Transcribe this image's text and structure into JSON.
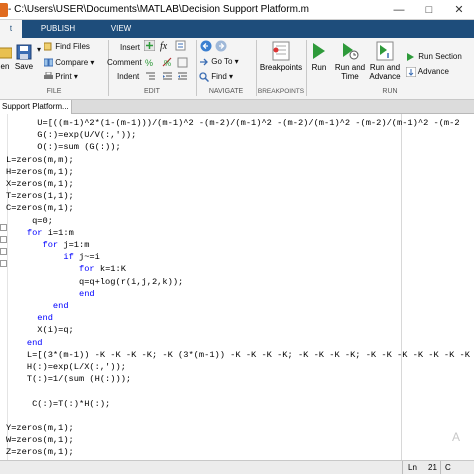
{
  "window": {
    "title": "- C:\\Users\\USER\\Documents\\MATLAB\\Decision Support Platform.m",
    "min_glyph": "—",
    "max_glyph": "□",
    "close_glyph": "✕"
  },
  "tabs": [
    {
      "label": "t"
    },
    {
      "label": "PUBLISH"
    },
    {
      "label": "VIEW"
    }
  ],
  "ribbon": {
    "file": {
      "open_label": "en",
      "save_label": "Save",
      "find_files": "Find Files",
      "compare": "Compare",
      "print": "Print",
      "group": "FILE"
    },
    "edit": {
      "insert": "Insert",
      "comment": "Comment",
      "indent": "Indent",
      "group": "EDIT"
    },
    "navigate": {
      "goto": "Go To",
      "find": "Find",
      "group": "NAVIGATE"
    },
    "breakpoints": {
      "label": "Breakpoints",
      "group": "BREAKPOINTS"
    },
    "run": {
      "run": "Run",
      "run_and_time": "Run and Time",
      "run_and_advance": "Run and Advance",
      "run_section": "Run Section",
      "advance": "Advance",
      "group": "RUN"
    },
    "fx_glyph": "fx"
  },
  "editor": {
    "tab_label": "Support Platform..."
  },
  "code_lines": [
    "      U=[((m-1)^2*(1-(m-1)))/(m-1)^2 -(m-2)/(m-1)^2 -(m-2)/(m-1)^2 -(m-2)/(m-1)^2 -(m-2",
    "      G(:)=exp(U/V(:,'));",
    "      O(:)=sum (G(:));",
    "L=zeros(m,m);",
    "H=zeros(m,1);",
    "X=zeros(m,1);",
    "T=zeros(1,1);",
    "C=zeros(m,1);",
    "     q=0;",
    "    for i=1:m",
    "       for j=1:m",
    "           if j~=i",
    "              for k=1:K",
    "              q=q+log(r(i,j,2,k));",
    "              end",
    "         end",
    "      end",
    "      X(i)=q;",
    "    end",
    "    L=[(3*(m-1)) -K -K -K -K; -K (3*(m-1)) -K -K -K -K; -K -K -K -K; -K -K -K -K -K -K -K -K -K",
    "    H(:)=exp(L/X(:,'));",
    "    T(:)=1/(sum (H(:)));",
    "",
    "     C(:)=T(:)*H(:);",
    "",
    "Y=zeros(m,1);",
    "W=zeros(m,1);",
    "Z=zeros(m,1);",
    "      "
  ],
  "keywords": [
    "for",
    "if",
    "end"
  ],
  "status": {
    "ln_label": "Ln",
    "ln_value": "21",
    "col_label": "C"
  },
  "watermark": "A",
  "colors": {
    "ribbon_tab_bg": "#1e4d7b",
    "ribbon_bg": "#f4f4f4",
    "keyword": "#0000ff",
    "run_green": "#2e9a3a"
  }
}
